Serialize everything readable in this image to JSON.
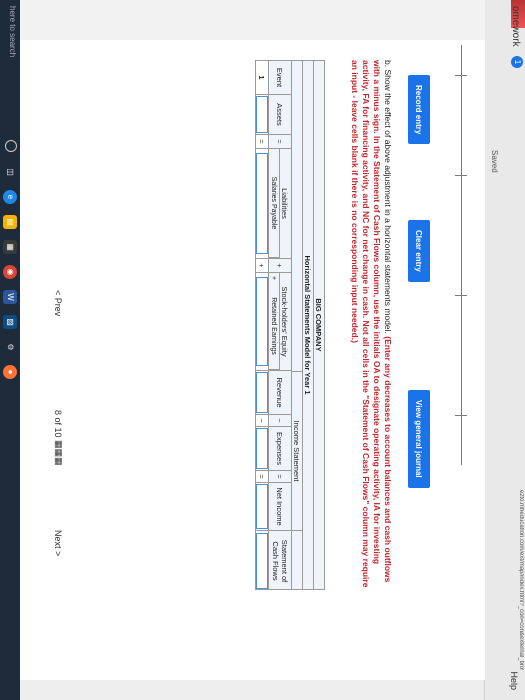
{
  "header": {
    "title": "omework",
    "badge": "1",
    "help": "Help",
    "url": "ezto.mheducation.com/ext/map/index.html?_con=con&external_browser=0&launchUrl=...",
    "saved": "Saved"
  },
  "sidebar": {
    "ok": "ok"
  },
  "buttons": {
    "record": "Record entry",
    "clear": "Clear entry",
    "view_journal": "View general journal"
  },
  "instructions": {
    "prefix": "b. Show the effect of above adjustment in a horizontal statements model.",
    "emphasis": "(Enter any decreases to account balances and cash outflows with a minus sign. In the Statement of Cash Flows column, use the initials OA to designate operating activity, IA for investing activity, FA for financing activity, and NC for net change in cash. Not all cells in the \"Statement of Cash Flows\" column may require an input - leave cells blank if there is no corresponding input needed.)"
  },
  "table": {
    "company": "BIG COMPANY",
    "model": "Horizontal Statements Model for Year 1",
    "section_income": "Income Statement",
    "headers": {
      "event": "Event",
      "assets": "Assets",
      "equals": "=",
      "liabilities": "Liabilities",
      "plus1": "+",
      "stockholders": "Stock-holders' Equity",
      "salaries_payable": "Salaries Payable",
      "plus2": "+",
      "retained_earnings": "Retained Earnings",
      "revenue": "Revenue",
      "minus": "−",
      "expenses": "Expenses",
      "equals2": "=",
      "net_income": "Net Income",
      "cash_flows": "Statement of Cash Flows"
    },
    "row": {
      "event": "1",
      "op1": "=",
      "op2": "+",
      "op3": "",
      "op4": "−",
      "op5": "="
    }
  },
  "pager": {
    "prev": "< Prev",
    "count": "8 of 10",
    "grid_icon": "grid-icon",
    "next": "Next >"
  },
  "taskbar": {
    "search": "here to search",
    "icons": [
      "cortana-icon",
      "task-view-icon",
      "edge-icon",
      "file-explorer-icon",
      "store-icon",
      "chrome-icon",
      "word-icon",
      "photos-icon",
      "settings-icon",
      "firefox-icon"
    ]
  }
}
